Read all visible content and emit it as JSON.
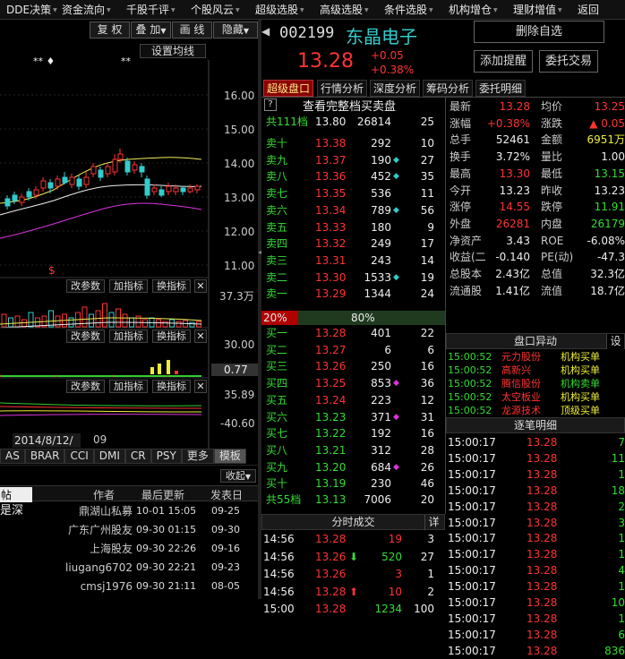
{
  "topbar": {
    "items": [
      "DDE决策",
      "资金流向",
      "千股千评",
      "个股风云",
      "超级选股",
      "高级选股",
      "条件选股",
      "机构增仓",
      "理财增值",
      "返回"
    ]
  },
  "chart": {
    "buttons": [
      "复 权",
      "叠 加",
      "画 线",
      "隐藏"
    ],
    "settings": "设置均线",
    "price_ticks": [
      "16.00",
      "15.00",
      "14.00",
      "13.00",
      "12.00",
      "11.00"
    ],
    "vol_ticks": [
      "37.3万"
    ],
    "ind_ticks": [
      "30.00",
      "0.77"
    ],
    "ind2_ticks": [
      "35.89",
      "-40.60"
    ],
    "sub_buttons": [
      "改参数",
      "加指标",
      "换指标"
    ],
    "date": "2014/8/12/二",
    "date2": "09",
    "tabs": [
      "AS",
      "BRAR",
      "CCI",
      "DMI",
      "CR",
      "PSY",
      "更多",
      "模板"
    ],
    "collapse": "收起",
    "marks": "** ♦",
    "mark2": "**",
    "dollar": "$"
  },
  "forum": {
    "headers": [
      "帖",
      "作者",
      "最后更新",
      "发表日"
    ],
    "rows": [
      {
        "t": "是深",
        "a": "鼎湖山私募",
        "u": "10-01 15:05",
        "d": "09-25"
      },
      {
        "t": "",
        "a": "广东广州股友",
        "u": "09-30 01:15",
        "d": "09-30"
      },
      {
        "t": "",
        "a": "上海股友",
        "u": "09-30 22:26",
        "d": "09-16"
      },
      {
        "t": "",
        "a": "liugang6702",
        "u": "09-30 22:21",
        "d": "09-23"
      },
      {
        "t": "",
        "a": "cmsj1976",
        "u": "09-30 21:11",
        "d": "08-05"
      }
    ]
  },
  "stock": {
    "code": "002199",
    "name": "东晶电子",
    "price": "13.28",
    "chg": "+0.05",
    "pct": "+0.38%"
  },
  "actions": {
    "del": "删除自选",
    "alert": "添加提醒",
    "trade": "委托交易"
  },
  "tabs": [
    "超级盘口",
    "行情分析",
    "深度分析",
    "筹码分析",
    "委托明细"
  ],
  "book": {
    "help": "?",
    "title": "查看完整档买卖盘",
    "sell_total": {
      "label": "共111档",
      "price": "13.80",
      "vol": "26814",
      "n": "25"
    },
    "sells": [
      {
        "l": "卖十",
        "p": "13.38",
        "v": "292",
        "m": "",
        "n": "10"
      },
      {
        "l": "卖九",
        "p": "13.37",
        "v": "190",
        "m": "◆",
        "n": "27"
      },
      {
        "l": "卖八",
        "p": "13.36",
        "v": "452",
        "m": "◆",
        "n": "35"
      },
      {
        "l": "卖七",
        "p": "13.35",
        "v": "536",
        "m": "",
        "n": "11"
      },
      {
        "l": "卖六",
        "p": "13.34",
        "v": "789",
        "m": "◆",
        "n": "56"
      },
      {
        "l": "卖五",
        "p": "13.33",
        "v": "180",
        "m": "",
        "n": "9"
      },
      {
        "l": "卖四",
        "p": "13.32",
        "v": "249",
        "m": "",
        "n": "17"
      },
      {
        "l": "卖三",
        "p": "13.31",
        "v": "243",
        "m": "",
        "n": "14"
      },
      {
        "l": "卖二",
        "p": "13.30",
        "v": "1533",
        "m": "◆",
        "n": "19"
      },
      {
        "l": "卖一",
        "p": "13.29",
        "v": "1344",
        "m": "",
        "n": "24"
      }
    ],
    "ratio_sell": "20%",
    "ratio_buy": "80%",
    "ratio_sell_frac": 0.2,
    "buys": [
      {
        "l": "买一",
        "p": "13.28",
        "v": "401",
        "m": "",
        "n": "22"
      },
      {
        "l": "买二",
        "p": "13.27",
        "v": "6",
        "m": "",
        "n": "6"
      },
      {
        "l": "买三",
        "p": "13.26",
        "v": "250",
        "m": "",
        "n": "16"
      },
      {
        "l": "买四",
        "p": "13.25",
        "v": "853",
        "m": "◆",
        "n": "36"
      },
      {
        "l": "买五",
        "p": "13.24",
        "v": "223",
        "m": "",
        "n": "12"
      },
      {
        "l": "买六",
        "p": "13.23",
        "v": "371",
        "m": "◆",
        "n": "31"
      },
      {
        "l": "买七",
        "p": "13.22",
        "v": "192",
        "m": "",
        "n": "16"
      },
      {
        "l": "买八",
        "p": "13.21",
        "v": "312",
        "m": "",
        "n": "28"
      },
      {
        "l": "买九",
        "p": "13.20",
        "v": "684",
        "m": "◆",
        "n": "26"
      },
      {
        "l": "买十",
        "p": "13.19",
        "v": "230",
        "m": "",
        "n": "46"
      }
    ],
    "buy_total": {
      "label": "共55档",
      "price": "13.13",
      "vol": "7006",
      "n": "20"
    }
  },
  "stats": [
    {
      "a": "最新",
      "av": "13.28",
      "ac": "red",
      "b": "均价",
      "bv": "13.25",
      "bc": "red"
    },
    {
      "a": "涨幅",
      "av": "+0.38%",
      "ac": "red",
      "b": "涨跌",
      "bv": "▲ 0.05",
      "bc": "red"
    },
    {
      "a": "总手",
      "av": "52461",
      "ac": "wht",
      "b": "金额",
      "bv": "6951万",
      "bc": "yel"
    },
    {
      "a": "换手",
      "av": "3.72%",
      "ac": "wht",
      "b": "量比",
      "bv": "1.00",
      "bc": "wht"
    },
    {
      "a": "最高",
      "av": "13.30",
      "ac": "red",
      "b": "最低",
      "bv": "13.15",
      "bc": "grn"
    },
    {
      "a": "今开",
      "av": "13.23",
      "ac": "wht",
      "b": "昨收",
      "bv": "13.23",
      "bc": "wht"
    },
    {
      "a": "涨停",
      "av": "14.55",
      "ac": "red",
      "b": "跌停",
      "bv": "11.91",
      "bc": "grn"
    },
    {
      "a": "外盘",
      "av": "26281",
      "ac": "red",
      "b": "内盘",
      "bv": "26179",
      "bc": "grn"
    },
    {
      "a": "净资产",
      "av": "3.43",
      "ac": "wht",
      "b": "ROE",
      "bv": "-6.08%",
      "bc": "wht"
    },
    {
      "a": "收益(二",
      "av": "-0.140",
      "ac": "wht",
      "b": "PE(动)",
      "bv": "-47.3",
      "bc": "wht"
    },
    {
      "a": "总股本",
      "av": "2.43亿",
      "ac": "wht",
      "b": "总值",
      "bv": "32.3亿",
      "bc": "wht"
    },
    {
      "a": "流通股",
      "av": "1.41亿",
      "ac": "wht",
      "b": "流值",
      "bv": "18.7亿",
      "bc": "wht"
    }
  ],
  "yidong": {
    "title": "盘口异动",
    "settings": "设",
    "rows": [
      {
        "t": "15:00:52",
        "n": "元力股份",
        "e": "机构买单"
      },
      {
        "t": "15:00:52",
        "n": "高新兴",
        "e": "机构买单"
      },
      {
        "t": "15:00:52",
        "n": "腾信股份",
        "e": "机构卖单"
      },
      {
        "t": "15:00:52",
        "n": "太空板业",
        "e": "机构买单"
      },
      {
        "t": "15:00:52",
        "n": "龙源技术",
        "e": "顶级买单"
      }
    ]
  },
  "zhubi": {
    "title": "逐笔明细",
    "rows": [
      {
        "t": "15:00:17",
        "p": "13.28",
        "v": "7"
      },
      {
        "t": "15:00:17",
        "p": "13.28",
        "v": "11"
      },
      {
        "t": "15:00:17",
        "p": "13.28",
        "v": "1"
      },
      {
        "t": "15:00:17",
        "p": "13.28",
        "v": "18"
      },
      {
        "t": "15:00:17",
        "p": "13.28",
        "v": "2"
      },
      {
        "t": "15:00:17",
        "p": "13.28",
        "v": "3"
      },
      {
        "t": "15:00:17",
        "p": "13.28",
        "v": "1"
      },
      {
        "t": "15:00:17",
        "p": "13.28",
        "v": "1"
      },
      {
        "t": "15:00:17",
        "p": "13.28",
        "v": "4"
      },
      {
        "t": "15:00:17",
        "p": "13.28",
        "v": "1"
      },
      {
        "t": "15:00:17",
        "p": "13.28",
        "v": "10"
      },
      {
        "t": "15:00:17",
        "p": "13.28",
        "v": "1"
      },
      {
        "t": "15:00:17",
        "p": "13.28",
        "v": "6"
      },
      {
        "t": "15:00:17",
        "p": "13.28",
        "v": "836"
      }
    ]
  },
  "fenshi": {
    "title": "分时成交",
    "detail": "详",
    "rows": [
      {
        "t": "14:56",
        "p": "13.28",
        "a": "",
        "v": "19",
        "n": "3",
        "vc": "red"
      },
      {
        "t": "14:56",
        "p": "13.26",
        "a": "⬇",
        "v": "520",
        "n": "27",
        "vc": "grn"
      },
      {
        "t": "14:56",
        "p": "13.26",
        "a": "",
        "v": "3",
        "n": "1",
        "vc": "red"
      },
      {
        "t": "14:56",
        "p": "13.28",
        "a": "⬆",
        "v": "10",
        "n": "2",
        "vc": "red"
      },
      {
        "t": "15:00",
        "p": "13.28",
        "a": "",
        "v": "1234",
        "n": "100",
        "vc": "grn"
      }
    ]
  }
}
